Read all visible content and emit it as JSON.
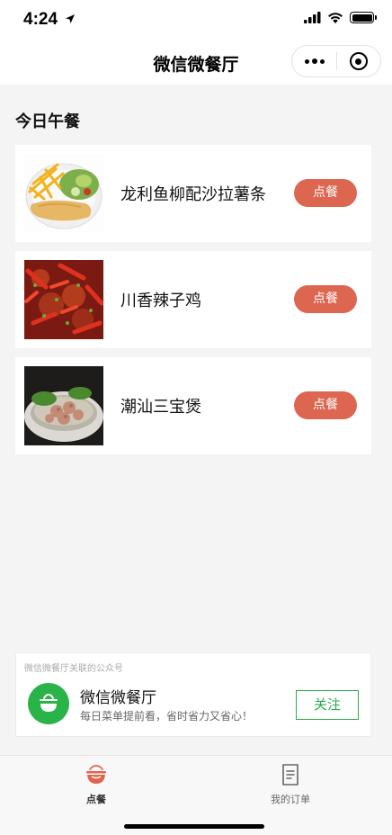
{
  "status_bar": {
    "time": "4:24",
    "icons": [
      "location-arrow-icon",
      "signal-icon",
      "wifi-icon",
      "battery-icon"
    ]
  },
  "nav_bar": {
    "title": "微信微餐厅",
    "capsule_icons": [
      "more-dots-icon",
      "close-target-icon"
    ]
  },
  "section": {
    "title": "今日午餐"
  },
  "menu": {
    "items": [
      {
        "name": "龙利鱼柳配沙拉薯条",
        "button_label": "点餐",
        "image": "fish-salad-fries-image"
      },
      {
        "name": "川香辣子鸡",
        "button_label": "点餐",
        "image": "spicy-chicken-image"
      },
      {
        "name": "潮汕三宝煲",
        "button_label": "点餐",
        "image": "chaoshan-soup-image"
      }
    ]
  },
  "official_account": {
    "header": "微信微餐厅关联的公众号",
    "name": "微信微餐厅",
    "description": "每日菜单提前看，省时省力又省心！",
    "follow_label": "关注",
    "icon": "bowl-logo-icon"
  },
  "tab_bar": {
    "tabs": [
      {
        "label": "点餐",
        "icon": "bowl-icon",
        "active": true
      },
      {
        "label": "我的订单",
        "icon": "order-list-icon",
        "active": false
      }
    ]
  },
  "colors": {
    "accent_order": "#dd6650",
    "accent_follow": "#2bab48",
    "background": "#f4f4f4"
  }
}
